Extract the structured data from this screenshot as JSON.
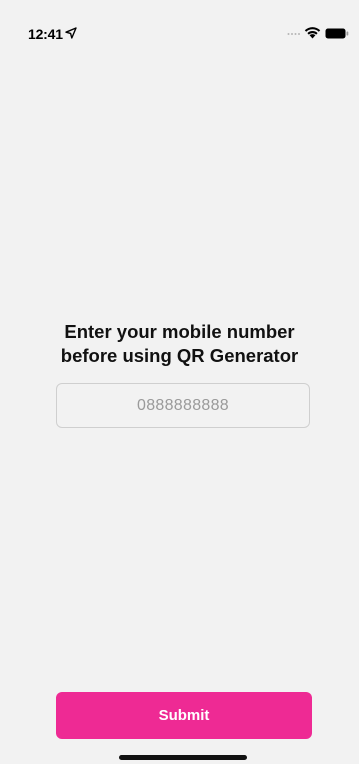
{
  "status_bar": {
    "time": "12:41",
    "icons": [
      "location-arrow-icon",
      "cellular-signal-icon",
      "wifi-icon",
      "battery-icon"
    ]
  },
  "prompt": {
    "line1": "Enter your mobile number",
    "line2": "before using QR Generator"
  },
  "phone_input": {
    "value": "",
    "placeholder": "0888888888"
  },
  "submit": {
    "label": "Submit"
  },
  "colors": {
    "background": "#f2f2f2",
    "accent": "#ee2a94",
    "input_border": "#cfcfcf",
    "text": "#111111"
  }
}
